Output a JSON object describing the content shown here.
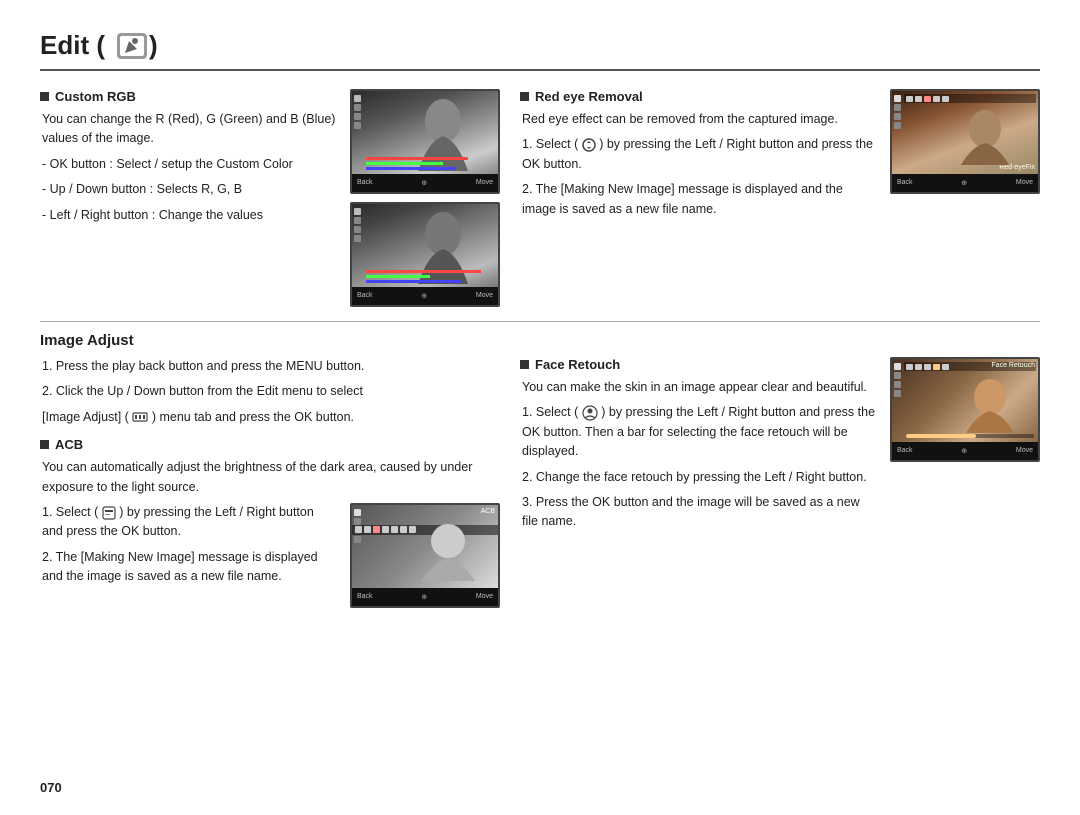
{
  "header": {
    "title": "Edit (",
    "title_end": ")",
    "icon_label": "edit-icon"
  },
  "top_left": {
    "section_title": "Custom RGB",
    "body_text": "You can change the R (Red), G (Green) and B (Blue) values of the image.",
    "bullet1": "- OK button : Select / setup the Custom Color",
    "bullet2": "- Up / Down button : Selects R, G, B",
    "bullet3": "- Left / Right button : Change the values"
  },
  "top_right": {
    "section_title": "Red eye Removal",
    "body_text": "Red eye effect can be removed from the captured image.",
    "step1_title": "1. Select (",
    "step1_icon": "scroll-icon",
    "step1_text": ") by pressing the Left / Right button and press the OK button.",
    "step2_text": "2. The [Making New Image] message is displayed and the image is saved as a new file name."
  },
  "image_adjust": {
    "heading": "Image Adjust",
    "step1": "1. Press the play back button and press the MENU button.",
    "step2": "2. Click the Up / Down button from the Edit menu to select",
    "step2b": "[Image Adjust] (",
    "step2c": ") menu tab and press the OK button.",
    "acb_title": "ACB",
    "acb_text": "You can automatically adjust the brightness of the dark area, caused by under exposure to the light source.",
    "acb_step1": "1. Select (",
    "acb_step1b": ") by pressing the Left / Right button and press the OK button.",
    "acb_step2": "2. The [Making New Image] message is displayed and the image is saved as a new file name."
  },
  "face_retouch": {
    "section_title": "Face Retouch",
    "body_text": "You can make the skin in an image appear clear and beautiful.",
    "step1": "1. Select (",
    "step1b": ") by pressing the Left / Right button and press the OK button. Then a bar for selecting the face retouch will be displayed.",
    "step2": "2. Change the face retouch by pressing the Left / Right button.",
    "step3": "3. Press the OK button and the image will be saved as a new file name."
  },
  "page_number": "070",
  "camera_screens": {
    "back_label": "Back",
    "move_label": "Move",
    "acb_label": "ACB",
    "red_eye_fix_label": "Red-eyeFix",
    "face_retouch_label": "Face Retouch"
  }
}
